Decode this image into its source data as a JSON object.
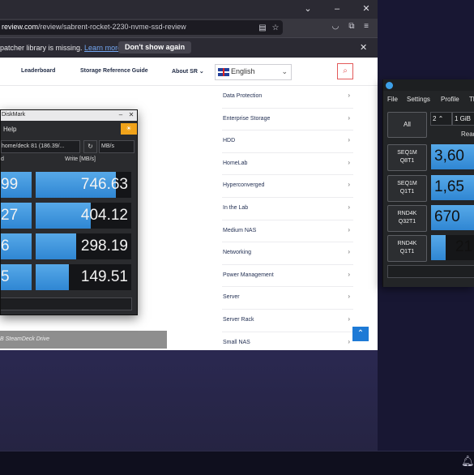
{
  "browser": {
    "url_host": "review.com",
    "url_path": "/review/sabrent-rocket-2230-nvme-ssd-review",
    "notification": {
      "text": "patcher library is missing.",
      "link": "Learn more",
      "dont_show": "Don't show again"
    },
    "nav": {
      "items": [
        "Leaderboard",
        "Storage Reference Guide",
        "About SR"
      ],
      "about_chevron": "⌄",
      "language": "English"
    },
    "categories": [
      "Data Protection",
      "Enterprise Storage",
      "HDD",
      "HomeLab",
      "Hyperconverged",
      "In the Lab",
      "Medium NAS",
      "Networking",
      "Power Management",
      "Server",
      "Server Rack",
      "Small NAS"
    ],
    "caption": "B SteamDeck Drive"
  },
  "diskmark": {
    "title": "DiskMark",
    "menu_help": "Help",
    "path": "home/deck 81 (186.39/...",
    "unit": "MB/s",
    "read_header": "d",
    "write_header": "Write [MB/s]",
    "read_values": [
      "99",
      "27",
      "6",
      "5"
    ],
    "write_values": [
      "746.63",
      "404.12",
      "298.19",
      "149.51"
    ],
    "write_fill": [
      0.84,
      0.58,
      0.42,
      0.35
    ]
  },
  "kdiskmark": {
    "menu": [
      "File",
      "Settings",
      "Profile",
      "Th"
    ],
    "all_label": "All",
    "runs": "2",
    "size": "1 GiB",
    "read_header": "Read",
    "tests": [
      {
        "line1": "SEQ1M",
        "line2": "Q8T1",
        "value": "3,60",
        "fill": 1.0
      },
      {
        "line1": "SEQ1M",
        "line2": "Q1T1",
        "value": "1,65",
        "fill": 1.0
      },
      {
        "line1": "RND4K",
        "line2": "Q32T1",
        "value": "670",
        "fill": 1.0
      },
      {
        "line1": "RND4K",
        "line2": "Q1T1",
        "value": "21",
        "fill": 0.3
      }
    ]
  },
  "colors": {
    "accent": "#2f86d3",
    "theme_button": "#f1a31a",
    "search_border": "#e35a5a"
  }
}
